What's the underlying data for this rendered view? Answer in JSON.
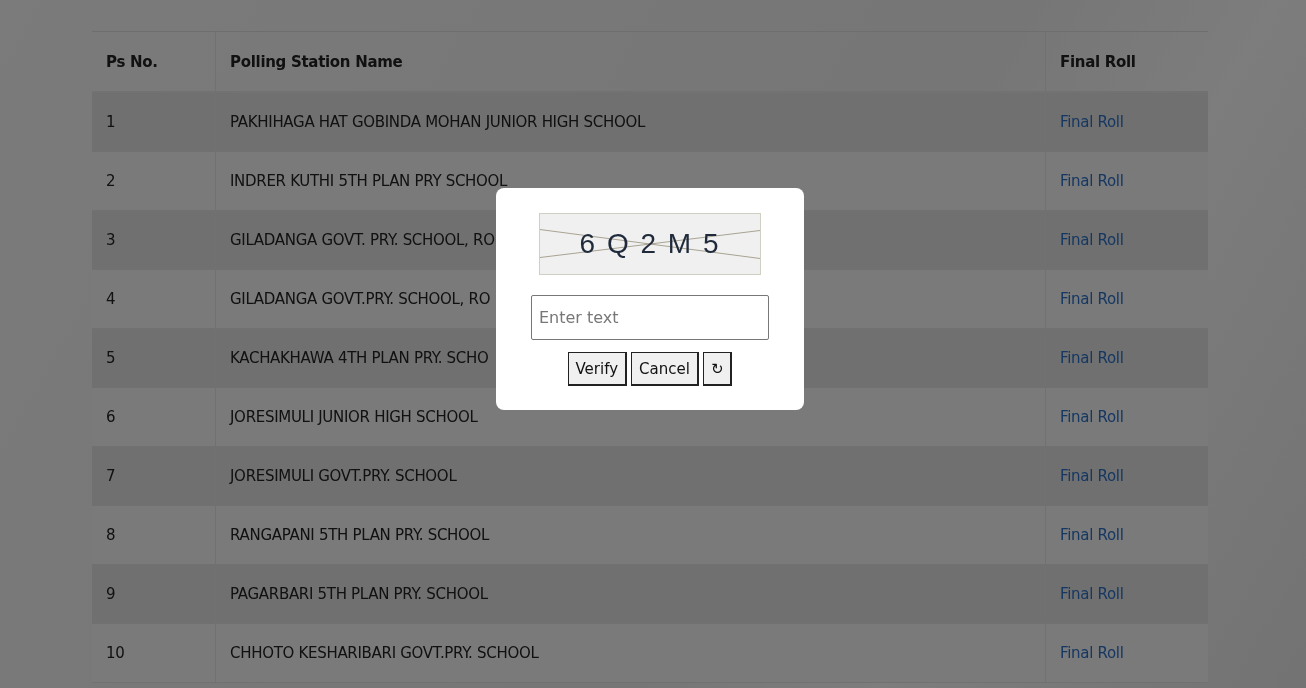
{
  "table": {
    "columns": [
      "Ps No.",
      "Polling Station Name",
      "Final Roll"
    ],
    "rows": [
      {
        "ps_no": "1",
        "name": "PAKHIHAGA HAT GOBINDA MOHAN JUNIOR HIGH SCHOOL",
        "link": "Final Roll"
      },
      {
        "ps_no": "2",
        "name": "INDRER KUTHI 5TH PLAN PRY SCHOOL",
        "link": "Final Roll"
      },
      {
        "ps_no": "3",
        "name": "GILADANGA GOVT. PRY. SCHOOL, RO",
        "link": "Final Roll"
      },
      {
        "ps_no": "4",
        "name": "GILADANGA GOVT.PRY. SCHOOL, RO",
        "link": "Final Roll"
      },
      {
        "ps_no": "5",
        "name": "KACHAKHAWA 4TH PLAN PRY. SCHO",
        "link": "Final Roll"
      },
      {
        "ps_no": "6",
        "name": "JORESIMULI JUNIOR HIGH SCHOOL",
        "link": "Final Roll"
      },
      {
        "ps_no": "7",
        "name": "JORESIMULI GOVT.PRY. SCHOOL",
        "link": "Final Roll"
      },
      {
        "ps_no": "8",
        "name": "RANGAPANI 5TH PLAN PRY. SCHOOL",
        "link": "Final Roll"
      },
      {
        "ps_no": "9",
        "name": "PAGARBARI 5TH PLAN PRY. SCHOOL",
        "link": "Final Roll"
      },
      {
        "ps_no": "10",
        "name": "CHHOTO KESHARIBARI GOVT.PRY. SCHOOL",
        "link": "Final Roll"
      }
    ]
  },
  "captcha_dialog": {
    "captcha_text": "6 Q 2 M 5",
    "input": {
      "placeholder": "Enter text"
    },
    "buttons": [
      "Verify",
      "Cancel",
      "↻"
    ]
  }
}
